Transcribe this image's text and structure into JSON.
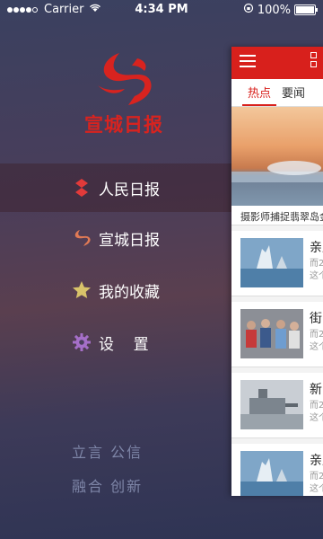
{
  "status_bar": {
    "carrier": "Carrier",
    "time": "4:34 PM",
    "battery": "100%",
    "battery_level": 1.0
  },
  "brand": {
    "logo_text": "宣城日报",
    "accent_color": "#d8231f"
  },
  "menu": {
    "items": [
      {
        "label": "人民日报",
        "icon": "people-daily-icon",
        "active": true
      },
      {
        "label": "宣城日报",
        "icon": "xuancheng-daily-icon",
        "active": false
      },
      {
        "label": "我的收藏",
        "icon": "star-icon",
        "active": false
      },
      {
        "label": "设    置",
        "icon": "gear-icon",
        "active": false
      }
    ]
  },
  "motto": {
    "line1": "立言 公信",
    "line2": "融合 创新"
  },
  "panel": {
    "tabs": [
      {
        "label": "热点",
        "active": true
      },
      {
        "label": "要闻",
        "active": false
      }
    ],
    "hero_caption": "摄影师捕捉翡翠岛金",
    "news": [
      {
        "title": "亲厉",
        "sub1": "而2",
        "sub2": "这个"
      },
      {
        "title": "街",
        "sub1": "而2",
        "sub2": "这个"
      },
      {
        "title": "新",
        "sub1": "而2",
        "sub2": "这个"
      },
      {
        "title": "亲厉",
        "sub1": "而2",
        "sub2": "这个"
      }
    ]
  }
}
